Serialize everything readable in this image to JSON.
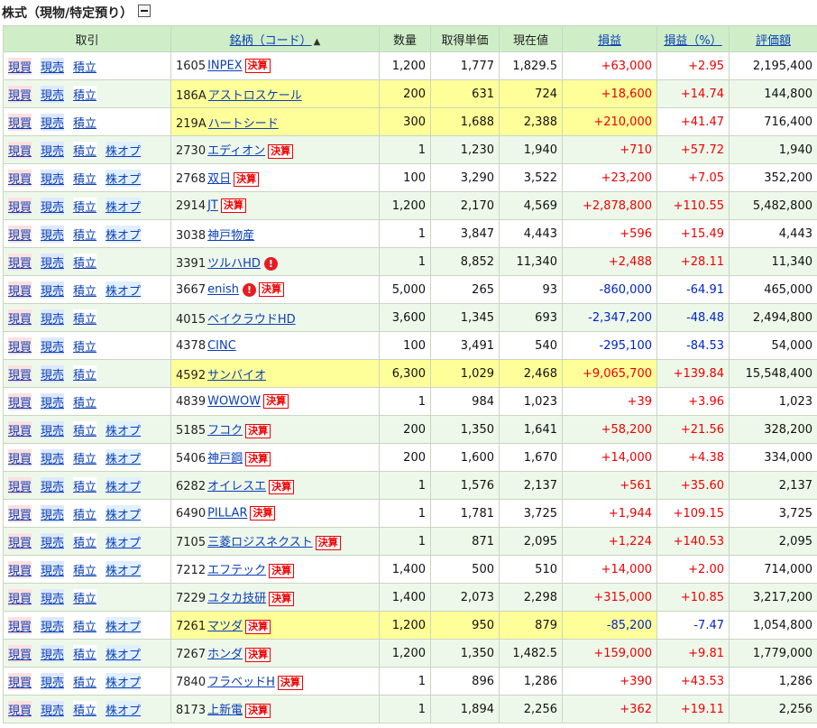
{
  "section": {
    "title": "株式（現物/特定預り）"
  },
  "headers": {
    "trade": "取引",
    "stock": "銘柄（コード）",
    "qty": "数量",
    "cost": "取得単価",
    "price": "現在値",
    "pl": "損益",
    "plpct": "損益（%）",
    "value": "評価額"
  },
  "actions": {
    "buy": "現買",
    "sell": "現売",
    "tsumi": "積立",
    "kabu": "株オプ"
  },
  "badge_label": "決算",
  "alert_glyph": "!",
  "colors": {
    "highlight": "#ffff99",
    "positive": "#e00000",
    "negative": "#0024c8",
    "header_bg": "#cfeec8"
  },
  "rows": [
    {
      "code": "1605",
      "name": "INPEX",
      "kabu": false,
      "badge": true,
      "alert": false,
      "qty": "1,200",
      "cost": "1,777",
      "price": "1,829.5",
      "pl": "+63,000",
      "plpct": "+2.95",
      "value": "2,195,400",
      "pos": true,
      "hl": false
    },
    {
      "code": "186A",
      "name": "アストロスケール",
      "kabu": false,
      "badge": false,
      "alert": false,
      "qty": "200",
      "cost": "631",
      "price": "724",
      "pl": "+18,600",
      "plpct": "+14.74",
      "value": "144,800",
      "pos": true,
      "hl": true
    },
    {
      "code": "219A",
      "name": "ハートシード",
      "kabu": false,
      "badge": false,
      "alert": false,
      "qty": "300",
      "cost": "1,688",
      "price": "2,388",
      "pl": "+210,000",
      "plpct": "+41.47",
      "value": "716,400",
      "pos": true,
      "hl": true
    },
    {
      "code": "2730",
      "name": "エディオン",
      "kabu": true,
      "badge": true,
      "alert": false,
      "qty": "1",
      "cost": "1,230",
      "price": "1,940",
      "pl": "+710",
      "plpct": "+57.72",
      "value": "1,940",
      "pos": true,
      "hl": false
    },
    {
      "code": "2768",
      "name": "双日",
      "kabu": true,
      "badge": true,
      "alert": false,
      "qty": "100",
      "cost": "3,290",
      "price": "3,522",
      "pl": "+23,200",
      "plpct": "+7.05",
      "value": "352,200",
      "pos": true,
      "hl": false
    },
    {
      "code": "2914",
      "name": "JT",
      "kabu": true,
      "badge": true,
      "alert": false,
      "qty": "1,200",
      "cost": "2,170",
      "price": "4,569",
      "pl": "+2,878,800",
      "plpct": "+110.55",
      "value": "5,482,800",
      "pos": true,
      "hl": false
    },
    {
      "code": "3038",
      "name": "神戸物産",
      "kabu": true,
      "badge": false,
      "alert": false,
      "qty": "1",
      "cost": "3,847",
      "price": "4,443",
      "pl": "+596",
      "plpct": "+15.49",
      "value": "4,443",
      "pos": true,
      "hl": false
    },
    {
      "code": "3391",
      "name": "ツルハHD",
      "kabu": false,
      "badge": false,
      "alert": true,
      "qty": "1",
      "cost": "8,852",
      "price": "11,340",
      "pl": "+2,488",
      "plpct": "+28.11",
      "value": "11,340",
      "pos": true,
      "hl": false
    },
    {
      "code": "3667",
      "name": "enish",
      "kabu": true,
      "badge": true,
      "alert": true,
      "qty": "5,000",
      "cost": "265",
      "price": "93",
      "pl": "-860,000",
      "plpct": "-64.91",
      "value": "465,000",
      "pos": false,
      "hl": false
    },
    {
      "code": "4015",
      "name": "ベイクラウドHD",
      "kabu": false,
      "badge": false,
      "alert": false,
      "qty": "3,600",
      "cost": "1,345",
      "price": "693",
      "pl": "-2,347,200",
      "plpct": "-48.48",
      "value": "2,494,800",
      "pos": false,
      "hl": false
    },
    {
      "code": "4378",
      "name": "CINC",
      "kabu": false,
      "badge": false,
      "alert": false,
      "qty": "100",
      "cost": "3,491",
      "price": "540",
      "pl": "-295,100",
      "plpct": "-84.53",
      "value": "54,000",
      "pos": false,
      "hl": false
    },
    {
      "code": "4592",
      "name": "サンバイオ",
      "kabu": false,
      "badge": false,
      "alert": false,
      "qty": "6,300",
      "cost": "1,029",
      "price": "2,468",
      "pl": "+9,065,700",
      "plpct": "+139.84",
      "value": "15,548,400",
      "pos": true,
      "hl": true
    },
    {
      "code": "4839",
      "name": "WOWOW",
      "kabu": false,
      "badge": true,
      "alert": false,
      "qty": "1",
      "cost": "984",
      "price": "1,023",
      "pl": "+39",
      "plpct": "+3.96",
      "value": "1,023",
      "pos": true,
      "hl": false
    },
    {
      "code": "5185",
      "name": "フコク",
      "kabu": true,
      "badge": true,
      "alert": false,
      "qty": "200",
      "cost": "1,350",
      "price": "1,641",
      "pl": "+58,200",
      "plpct": "+21.56",
      "value": "328,200",
      "pos": true,
      "hl": false
    },
    {
      "code": "5406",
      "name": "神戸鋼",
      "kabu": true,
      "badge": true,
      "alert": false,
      "qty": "200",
      "cost": "1,600",
      "price": "1,670",
      "pl": "+14,000",
      "plpct": "+4.38",
      "value": "334,000",
      "pos": true,
      "hl": false
    },
    {
      "code": "6282",
      "name": "オイレスエ",
      "kabu": true,
      "badge": true,
      "alert": false,
      "qty": "1",
      "cost": "1,576",
      "price": "2,137",
      "pl": "+561",
      "plpct": "+35.60",
      "value": "2,137",
      "pos": true,
      "hl": false
    },
    {
      "code": "6490",
      "name": "PILLAR",
      "kabu": true,
      "badge": true,
      "alert": false,
      "qty": "1",
      "cost": "1,781",
      "price": "3,725",
      "pl": "+1,944",
      "plpct": "+109.15",
      "value": "3,725",
      "pos": true,
      "hl": false
    },
    {
      "code": "7105",
      "name": "三菱ロジスネクスト",
      "kabu": true,
      "badge": true,
      "alert": false,
      "qty": "1",
      "cost": "871",
      "price": "2,095",
      "pl": "+1,224",
      "plpct": "+140.53",
      "value": "2,095",
      "pos": true,
      "hl": false
    },
    {
      "code": "7212",
      "name": "エフテック",
      "kabu": true,
      "badge": true,
      "alert": false,
      "qty": "1,400",
      "cost": "500",
      "price": "510",
      "pl": "+14,000",
      "plpct": "+2.00",
      "value": "714,000",
      "pos": true,
      "hl": false
    },
    {
      "code": "7229",
      "name": "ユタカ技研",
      "kabu": false,
      "badge": true,
      "alert": false,
      "qty": "1,400",
      "cost": "2,073",
      "price": "2,298",
      "pl": "+315,000",
      "plpct": "+10.85",
      "value": "3,217,200",
      "pos": true,
      "hl": false
    },
    {
      "code": "7261",
      "name": "マツダ",
      "kabu": true,
      "badge": true,
      "alert": false,
      "qty": "1,200",
      "cost": "950",
      "price": "879",
      "pl": "-85,200",
      "plpct": "-7.47",
      "value": "1,054,800",
      "pos": false,
      "hl": true
    },
    {
      "code": "7267",
      "name": "ホンダ",
      "kabu": true,
      "badge": true,
      "alert": false,
      "qty": "1,200",
      "cost": "1,350",
      "price": "1,482.5",
      "pl": "+159,000",
      "plpct": "+9.81",
      "value": "1,779,000",
      "pos": true,
      "hl": false
    },
    {
      "code": "7840",
      "name": "フラベッドH",
      "kabu": true,
      "badge": true,
      "alert": false,
      "qty": "1",
      "cost": "896",
      "price": "1,286",
      "pl": "+390",
      "plpct": "+43.53",
      "value": "1,286",
      "pos": true,
      "hl": false
    },
    {
      "code": "8173",
      "name": "上新電",
      "kabu": true,
      "badge": true,
      "alert": false,
      "qty": "1",
      "cost": "1,894",
      "price": "2,256",
      "pl": "+362",
      "plpct": "+19.11",
      "value": "2,256",
      "pos": true,
      "hl": false
    }
  ]
}
